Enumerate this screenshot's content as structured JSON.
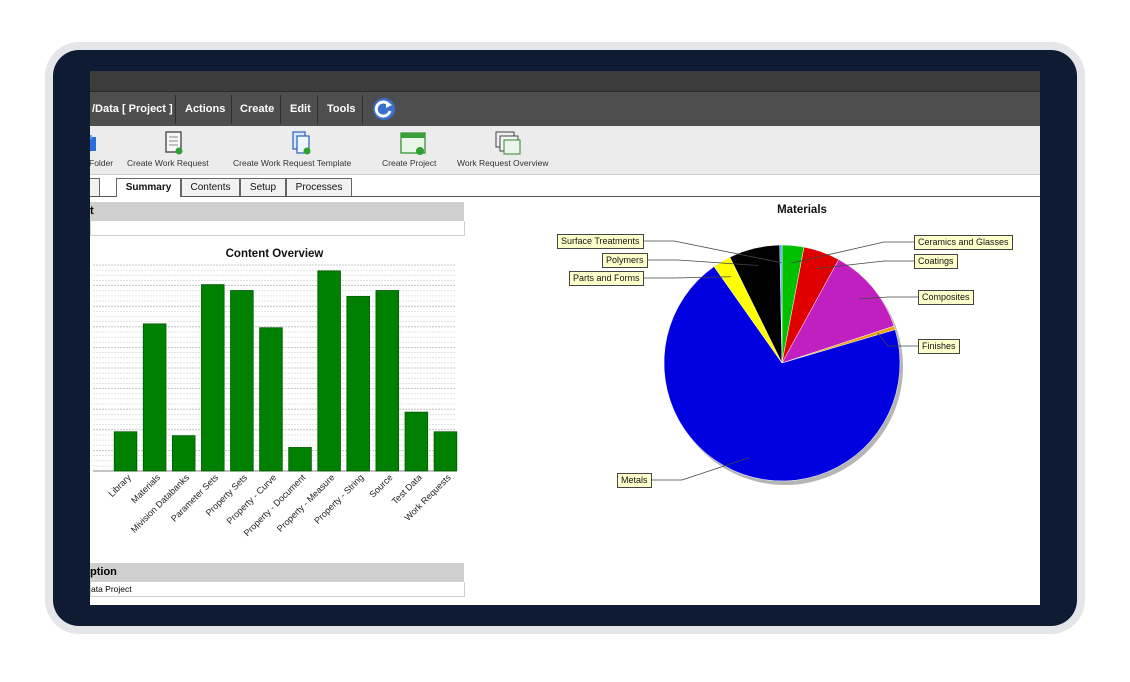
{
  "menubar": {
    "items": [
      "/Data [ Project ]",
      "Actions",
      "Create",
      "Edit",
      "Tools"
    ]
  },
  "toolbar": {
    "buttons": [
      {
        "label": "Folder",
        "icon": "folder-icon"
      },
      {
        "label": "Create Work Request",
        "icon": "work-request-icon"
      },
      {
        "label": "Create Work Request Template",
        "icon": "template-icon"
      },
      {
        "label": "Create Project",
        "icon": "project-icon"
      },
      {
        "label": "Work Request Overview",
        "icon": "overview-icon"
      }
    ]
  },
  "tabs": [
    "Summary",
    "Contents",
    "Setup",
    "Processes"
  ],
  "sections": {
    "top_head": "t",
    "description_head": "ption",
    "description_value": "ata Project"
  },
  "colors": {
    "bar": "#008000",
    "device": "#0f1a33",
    "menubar": "#4e4e4e",
    "callout": "#ffffcc"
  },
  "chart_data": [
    {
      "type": "bar",
      "title": "Content Overview",
      "categories": [
        "Library",
        "Materials",
        "Mivision Databanks",
        "Parameter Sets",
        "Property Sets",
        "Property - Curve",
        "Property - Document",
        "Property - Measure",
        "Property - String",
        "Source",
        "Test Data",
        "Work Requests"
      ],
      "values": [
        20,
        75,
        18,
        95,
        92,
        73,
        12,
        102,
        89,
        92,
        30,
        20
      ],
      "ylim": [
        0,
        105
      ],
      "grid": true,
      "color": "#008000"
    },
    {
      "type": "pie",
      "title": "Materials",
      "labels": [
        "Ceramics and Glasses",
        "Coatings",
        "Composites",
        "Finishes",
        "Metals",
        "Parts and Forms",
        "Polymers",
        "Surface Treatments"
      ],
      "values": [
        3,
        5,
        12,
        0.5,
        70,
        2.5,
        7,
        0.3
      ],
      "colors": [
        "#00c000",
        "#e00000",
        "#c020c0",
        "#f0a000",
        "#0000e0",
        "#ffff00",
        "#000000",
        "#40a0ff"
      ]
    }
  ]
}
